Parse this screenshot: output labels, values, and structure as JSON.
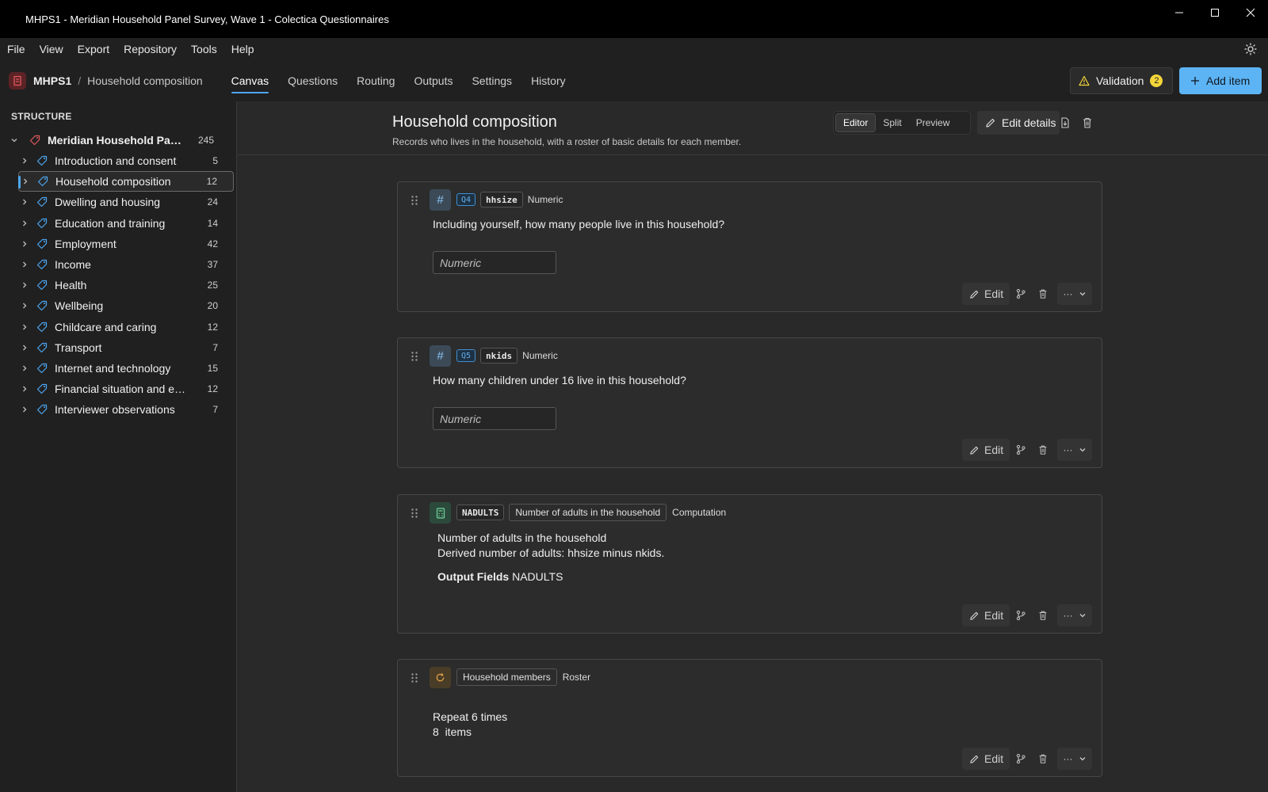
{
  "window": {
    "title": "MHPS1 - Meridian Household Panel Survey, Wave 1 - Colectica Questionnaires"
  },
  "menu": [
    "File",
    "View",
    "Export",
    "Repository",
    "Tools",
    "Help"
  ],
  "nav": {
    "crumb_project": "MHPS1",
    "crumb_sep": "/",
    "crumb_page": "Household composition",
    "tabs": [
      "Canvas",
      "Questions",
      "Routing",
      "Outputs",
      "Settings",
      "History"
    ],
    "active_tab": "Canvas",
    "validation_label": "Validation",
    "validation_count": "2",
    "add_item_label": "Add item"
  },
  "sidebar": {
    "heading": "STRUCTURE",
    "root": {
      "label": "Meridian Household Pane...",
      "count": "245"
    },
    "items": [
      {
        "label": "Introduction and consent",
        "count": "5"
      },
      {
        "label": "Household composition",
        "count": "12"
      },
      {
        "label": "Dwelling and housing",
        "count": "24"
      },
      {
        "label": "Education and training",
        "count": "14"
      },
      {
        "label": "Employment",
        "count": "42"
      },
      {
        "label": "Income",
        "count": "37"
      },
      {
        "label": "Health",
        "count": "25"
      },
      {
        "label": "Wellbeing",
        "count": "20"
      },
      {
        "label": "Childcare and caring",
        "count": "12"
      },
      {
        "label": "Transport",
        "count": "7"
      },
      {
        "label": "Internet and technology",
        "count": "15"
      },
      {
        "label": "Financial situation and ex...",
        "count": "12"
      },
      {
        "label": "Interviewer observations",
        "count": "7"
      }
    ],
    "selected_index": 1
  },
  "page": {
    "title": "Household composition",
    "subtitle": "Records who lives in the household, with a roster of basic details for each member.",
    "view_modes": [
      "Editor",
      "Split",
      "Preview"
    ],
    "active_view": "Editor",
    "edit_details_label": "Edit details"
  },
  "cards": {
    "q4": {
      "qnum": "Q4",
      "name": "hhsize",
      "type": "Numeric",
      "text": "Including yourself, how many people live in this household?",
      "placeholder": "Numeric",
      "edit": "Edit"
    },
    "q5": {
      "qnum": "Q5",
      "name": "nkids",
      "type": "Numeric",
      "text": "How many children under 16 live in this household?",
      "placeholder": "Numeric",
      "edit": "Edit"
    },
    "comp": {
      "name": "NADULTS",
      "label": "Number of adults in the household",
      "type": "Computation",
      "line1": "Number of adults in the household",
      "line2": "Derived number of adults: hhsize minus nkids.",
      "output_label": "Output Fields",
      "output_value": "NADULTS",
      "edit": "Edit"
    },
    "roster": {
      "label": "Household members",
      "type": "Roster",
      "repeat": "Repeat 6 times",
      "items": "8  items",
      "edit": "Edit"
    }
  },
  "colors": {
    "accent": "#4ca6f0",
    "add_button": "#5cb4f5",
    "badge": "#f3d53a"
  }
}
